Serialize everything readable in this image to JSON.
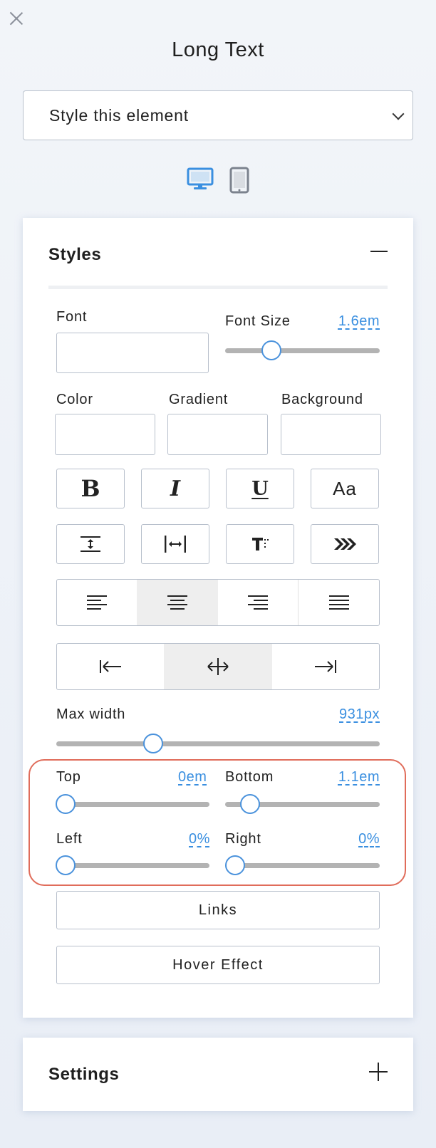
{
  "title": "Long Text",
  "element_select": {
    "value": "Style this element"
  },
  "devices": [
    "desktop-icon",
    "tablet-icon"
  ],
  "styles": {
    "heading": "Styles",
    "font": {
      "label": "Font",
      "value": ""
    },
    "font_size": {
      "label": "Font Size",
      "value": "1.6em",
      "level": 0.3
    },
    "color": {
      "label": "Color"
    },
    "gradient": {
      "label": "Gradient"
    },
    "background": {
      "label": "Background"
    },
    "format_buttons": [
      "B",
      "I",
      "U",
      "Aa"
    ],
    "spacing_buttons": [
      "line-height-icon",
      "letter-spacing-icon",
      "text-transform-icon",
      "text-effect-icon"
    ],
    "text_align": {
      "options": [
        "left",
        "center",
        "right",
        "justify"
      ],
      "selected": "center"
    },
    "block_align": {
      "options": [
        "left",
        "center",
        "right"
      ],
      "selected": "center"
    },
    "max_width": {
      "label": "Max width",
      "value": "931px",
      "level": 0.3
    },
    "margins": {
      "top": {
        "label": "Top",
        "value": "0em",
        "level": 0.0
      },
      "bottom": {
        "label": "Bottom",
        "value": "1.1em",
        "level": 0.16
      },
      "left": {
        "label": "Left",
        "value": "0%",
        "level": 0.0
      },
      "right": {
        "label": "Right",
        "value": "0%",
        "level": 0.0
      }
    },
    "links_button": "Links",
    "hover_button": "Hover Effect"
  },
  "settings": {
    "heading": "Settings"
  },
  "colors": {
    "accent": "#3a8fe0",
    "highlight": "#e06c5a"
  }
}
